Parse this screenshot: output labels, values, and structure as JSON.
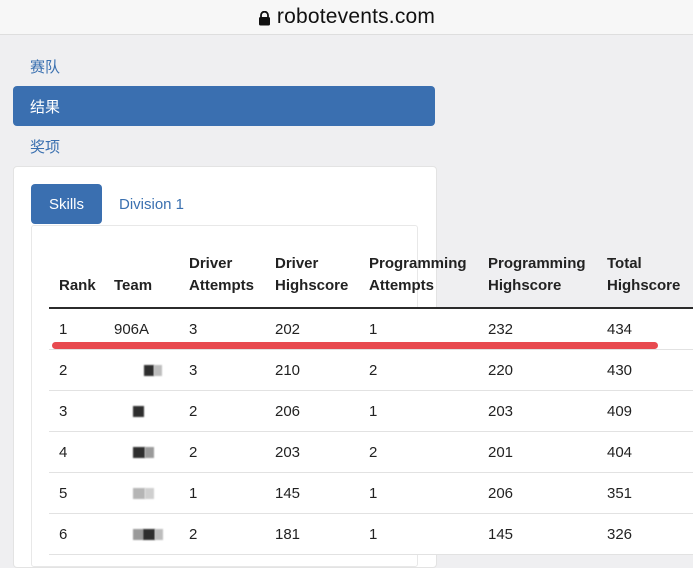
{
  "browser": {
    "url": "robotevents.com"
  },
  "nav": {
    "items": [
      {
        "label": "赛队",
        "active": false
      },
      {
        "label": "结果",
        "active": true
      },
      {
        "label": "奖项",
        "active": false
      }
    ]
  },
  "tabs": {
    "skills": "Skills",
    "division": "Division 1"
  },
  "table": {
    "headers": {
      "rank": "Rank",
      "team": "Team",
      "driver_attempts_1": "Driver",
      "driver_attempts_2": "Attempts",
      "driver_highscore_1": "Driver",
      "driver_highscore_2": "Highscore",
      "programming_attempts_1": "Programming",
      "programming_attempts_2": "Attempts",
      "programming_highscore_1": "Programming",
      "programming_highscore_2": "Highscore",
      "total_highscore_1": "Total",
      "total_highscore_2": "Highscore"
    },
    "rows": [
      {
        "rank": "1",
        "team": "906A",
        "driver_attempts": "3",
        "driver_highscore": "202",
        "programming_attempts": "1",
        "programming_highscore": "232",
        "total": "434"
      },
      {
        "rank": "2",
        "team": "",
        "driver_attempts": "3",
        "driver_highscore": "210",
        "programming_attempts": "2",
        "programming_highscore": "220",
        "total": "430"
      },
      {
        "rank": "3",
        "team": "",
        "driver_attempts": "2",
        "driver_highscore": "206",
        "programming_attempts": "1",
        "programming_highscore": "203",
        "total": "409"
      },
      {
        "rank": "4",
        "team": "",
        "driver_attempts": "2",
        "driver_highscore": "203",
        "programming_attempts": "2",
        "programming_highscore": "201",
        "total": "404"
      },
      {
        "rank": "5",
        "team": "",
        "driver_attempts": "1",
        "driver_highscore": "145",
        "programming_attempts": "1",
        "programming_highscore": "206",
        "total": "351"
      },
      {
        "rank": "6",
        "team": "",
        "driver_attempts": "2",
        "driver_highscore": "181",
        "programming_attempts": "1",
        "programming_highscore": "145",
        "total": "326"
      }
    ]
  },
  "colors": {
    "accent": "#3a6fb0",
    "highlight": "#e84a4f"
  }
}
